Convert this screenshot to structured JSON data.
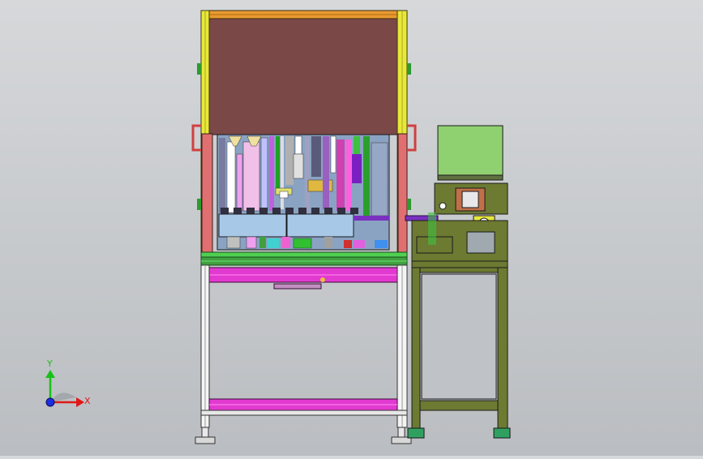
{
  "triad": {
    "x_label": "X",
    "y_label": "Y",
    "x_color": "#e01818",
    "y_color": "#18c018",
    "z_color": "#1a2fe0"
  },
  "colors": {
    "background": "#c8cbcf",
    "upper_cover": "#7b4848",
    "frame_yellow": "#e8e83a",
    "frame_orange": "#e89a30",
    "crossbar_magenta": "#e23ad0",
    "side_table": "#6c7a32",
    "control_box": "#8fd070",
    "frame_green": "#50d050",
    "window_interior": "#8aa3c2"
  },
  "icons": [
    "axis-triad-icon"
  ]
}
